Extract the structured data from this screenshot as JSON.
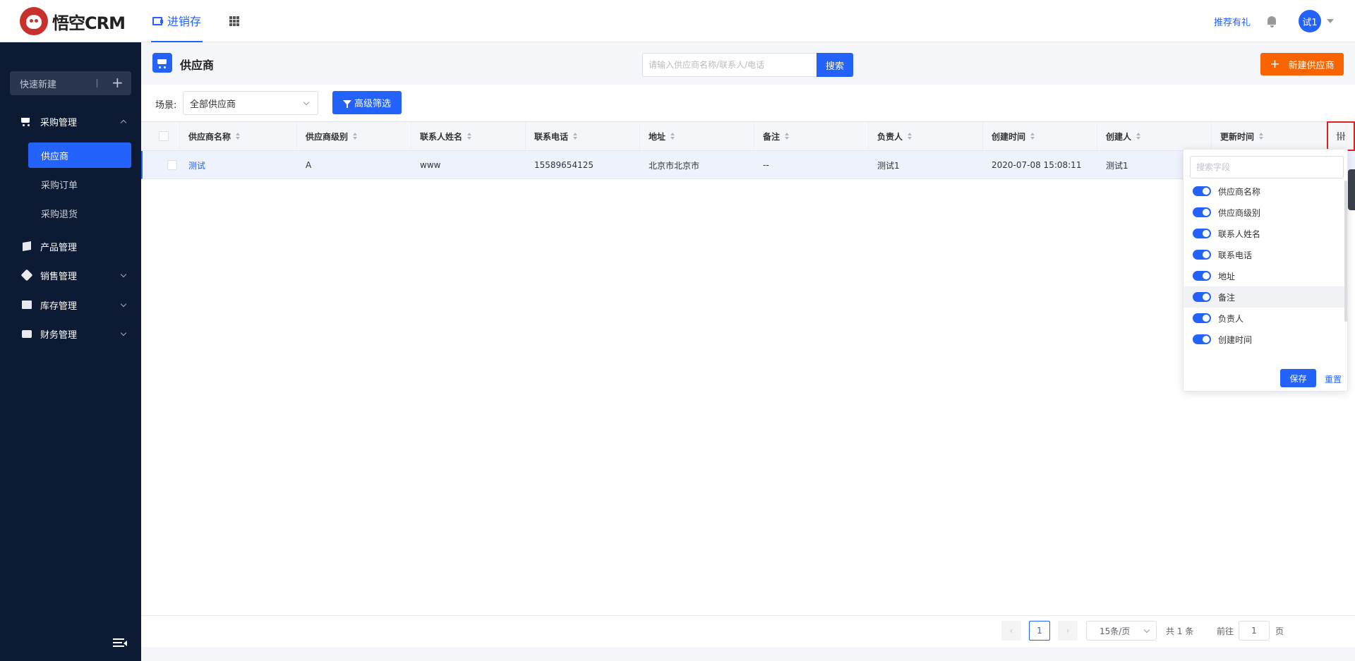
{
  "app": {
    "logo_text": "悟空CRM"
  },
  "top_nav": {
    "active_label": "进销存",
    "recommend": "推荐有礼",
    "avatar_text": "试1"
  },
  "sidebar": {
    "quick_new": "快速新建",
    "menus": [
      {
        "label": "采购管理"
      },
      {
        "label": "产品管理"
      },
      {
        "label": "销售管理"
      },
      {
        "label": "库存管理"
      },
      {
        "label": "财务管理"
      }
    ],
    "sub_items": [
      {
        "label": "供应商"
      },
      {
        "label": "采购订单"
      },
      {
        "label": "采购退货"
      }
    ]
  },
  "page": {
    "title": "供应商",
    "search_placeholder": "请输入供应商名称/联系人/电话",
    "search_button": "搜索",
    "new_button": "新建供应商"
  },
  "filter": {
    "scene_label": "场景:",
    "scene_value": "全部供应商",
    "advanced_button": "高级筛选"
  },
  "table": {
    "columns": [
      "供应商名称",
      "供应商级别",
      "联系人姓名",
      "联系电话",
      "地址",
      "备注",
      "负责人",
      "创建时间",
      "创建人",
      "更新时间"
    ],
    "rows": [
      [
        "测试",
        "A",
        "www",
        "15589654125",
        "北京市北京市",
        "--",
        "测试1",
        "2020-07-08 15:08:11",
        "测试1",
        ""
      ]
    ]
  },
  "column_panel": {
    "search_placeholder": "搜索字段",
    "fields": [
      "供应商名称",
      "供应商级别",
      "联系人姓名",
      "联系电话",
      "地址",
      "备注",
      "负责人",
      "创建时间"
    ],
    "highlighted_field_index": 5,
    "save": "保存",
    "reset": "重置"
  },
  "pagination": {
    "current_page": "1",
    "page_size": "15条/页",
    "total": "共 1 条",
    "goto_label": "前往",
    "goto_value": "1",
    "page_unit": "页"
  },
  "colors": {
    "primary": "#2362fb",
    "accent": "#fa6400",
    "sidebar": "#0d1a33"
  }
}
